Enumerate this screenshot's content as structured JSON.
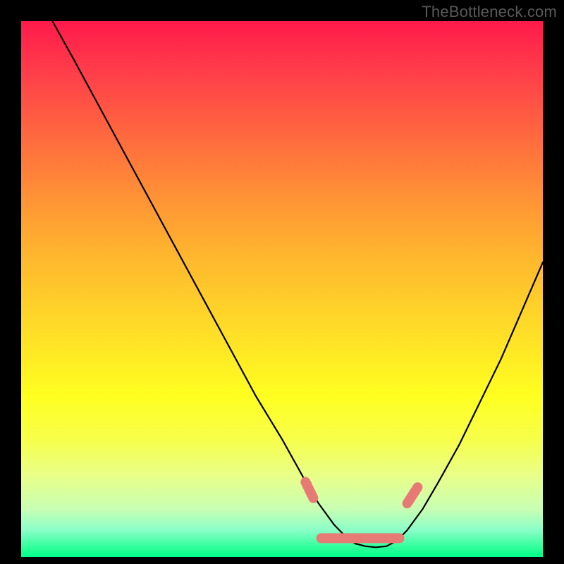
{
  "watermark": "TheBottleneck.com",
  "colors": {
    "marker": "#e77a74",
    "curve": "#000000",
    "gradient_top": "#ff1a4b",
    "gradient_bottom": "#00ff88"
  },
  "chart_data": {
    "type": "line",
    "title": "",
    "xlabel": "",
    "ylabel": "",
    "xlim": [
      0,
      100
    ],
    "ylim": [
      0,
      100
    ],
    "description": "Bottleneck deviation curve over a red-to-green heat gradient. Two descending branches meet in a near-flat trough; thick salmon markers highlight the trough band and the branch tips adjacent to it.",
    "series": [
      {
        "name": "bottleneck_curve",
        "x": [
          6,
          10,
          15,
          20,
          25,
          30,
          35,
          40,
          45,
          50,
          54,
          57,
          60,
          62,
          64,
          66,
          68,
          70,
          72,
          74,
          77,
          80,
          84,
          88,
          92,
          96,
          100
        ],
        "y": [
          100,
          93,
          84,
          75,
          66,
          57,
          48,
          39,
          30,
          22,
          15,
          10,
          6,
          4,
          2.5,
          2,
          1.8,
          2,
          3,
          5,
          9,
          14,
          21,
          29,
          37,
          46,
          55
        ]
      }
    ],
    "markers": {
      "name": "trough_highlight",
      "segments": [
        {
          "x": [
            54.5,
            56
          ],
          "y": [
            14,
            11
          ]
        },
        {
          "x": [
            57.5,
            72.5
          ],
          "y": [
            3.5,
            3.5
          ]
        },
        {
          "x": [
            74,
            76
          ],
          "y": [
            10,
            13
          ]
        }
      ]
    }
  }
}
